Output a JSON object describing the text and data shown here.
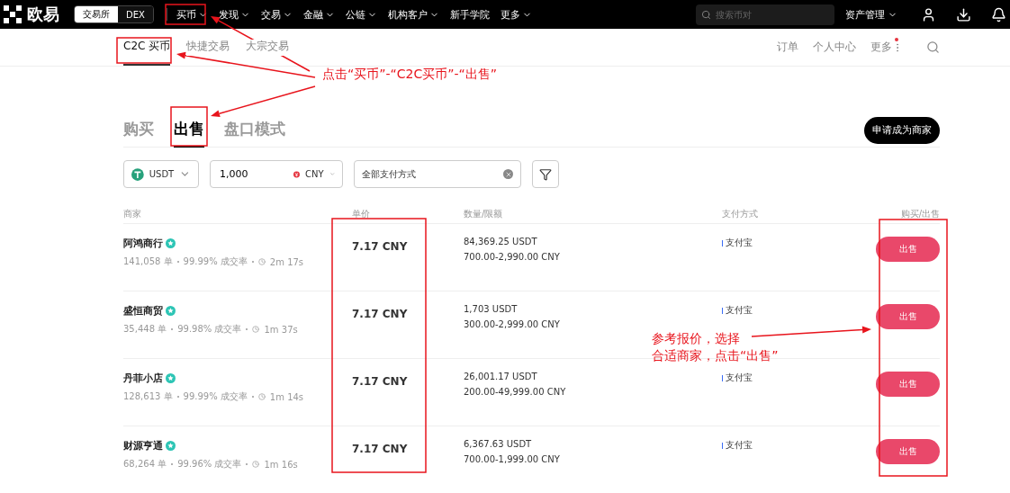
{
  "top_nav": {
    "logo": "欧易",
    "mode_toggle": [
      {
        "label": "交易所",
        "selected": true
      },
      {
        "label": "DEX",
        "selected": false
      }
    ],
    "items": [
      {
        "label": "买币",
        "dropdown": true
      },
      {
        "label": "发现",
        "dropdown": true
      },
      {
        "label": "交易",
        "dropdown": true
      },
      {
        "label": "金融",
        "dropdown": true
      },
      {
        "label": "公链",
        "dropdown": true
      },
      {
        "label": "机构客户",
        "dropdown": true
      },
      {
        "label": "新手学院",
        "dropdown": false
      },
      {
        "label": "更多",
        "dropdown": true
      }
    ],
    "search": {
      "placeholder": "搜索币对"
    },
    "asset_menu": "资产管理"
  },
  "sub_nav": {
    "tabs": [
      {
        "label": "C2C 买币",
        "selected": true
      },
      {
        "label": "快捷交易",
        "selected": false
      },
      {
        "label": "大宗交易",
        "selected": false
      }
    ],
    "links": [
      {
        "label": "订单",
        "kind": "link"
      },
      {
        "label": "个人中心",
        "kind": "link"
      },
      {
        "label": "更多",
        "kind": "more"
      }
    ]
  },
  "trade_tabs": [
    {
      "label": "购买",
      "selected": false
    },
    {
      "label": "出售",
      "selected": true
    },
    {
      "label": "盘口模式",
      "selected": false
    }
  ],
  "merchant_button": "申请成为商家",
  "filters": {
    "coin": "USDT",
    "amount": "1,000",
    "currency": "CNY",
    "payment": "全部支付方式"
  },
  "table": {
    "columns": [
      "商家",
      "单价",
      "数量/限额",
      "支付方式",
      "购买/出售"
    ],
    "rows": [
      {
        "merchant": "阿鸿商行",
        "orders": "141,058 单",
        "rate": "99.99% 成交率",
        "time": "2m 17s",
        "price": "7.17 CNY",
        "quantity": "84,369.25 USDT",
        "limit": "700.00-2,990.00 CNY",
        "payment": "支付宝",
        "action": "出售"
      },
      {
        "merchant": "盛恒商贸",
        "orders": "35,448 单",
        "rate": "99.98% 成交率",
        "time": "1m 37s",
        "price": "7.17 CNY",
        "quantity": "1,703 USDT",
        "limit": "300.00-2,999.00 CNY",
        "payment": "支付宝",
        "action": "出售"
      },
      {
        "merchant": "丹菲小店",
        "orders": "128,613 单",
        "rate": "99.99% 成交率",
        "time": "1m 14s",
        "price": "7.17 CNY",
        "quantity": "26,001.17 USDT",
        "limit": "200.00-49,999.00 CNY",
        "payment": "支付宝",
        "action": "出售"
      },
      {
        "merchant": "财源亨通",
        "orders": "68,264 单",
        "rate": "99.96% 成交率",
        "time": "1m 16s",
        "price": "7.17 CNY",
        "quantity": "6,367.63 USDT",
        "limit": "700.00-1,999.00 CNY",
        "payment": "支付宝",
        "action": "出售"
      }
    ]
  },
  "annotations": [
    {
      "text": "点击“买币”-“C2C买币”-“出售”"
    },
    {
      "text": "参考报价，选择"
    },
    {
      "text": "合适商家，点击“出售”"
    }
  ]
}
